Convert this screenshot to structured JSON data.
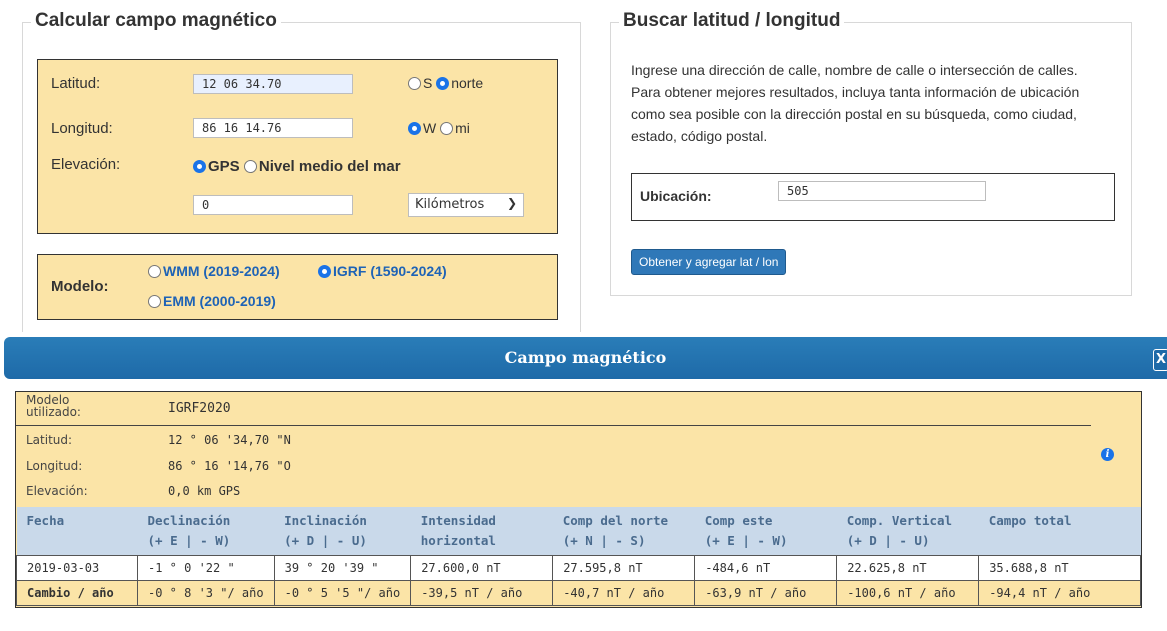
{
  "calc": {
    "title": "Calcular campo magnético",
    "lat_label": "Latitud:",
    "lat_value": "12 06 34.70",
    "lat_opt_s": "S",
    "lat_opt_n": "norte",
    "lat_selected": "norte",
    "lon_label": "Longitud:",
    "lon_value": "86 16 14.76",
    "lon_opt_w": "W",
    "lon_opt_e": "mi",
    "lon_selected": "W",
    "elev_label": "Elevación:",
    "elev_opt_gps": "GPS",
    "elev_opt_msl": "Nivel medio del mar",
    "elev_selected": "GPS",
    "elev_value": "0",
    "elev_unit": "Kilómetros",
    "model_label": "Modelo:",
    "model_opts": [
      "WMM (2019-2024)",
      "IGRF (1590-2024)",
      "EMM (2000-2019)"
    ],
    "model_selected": "IGRF (1590-2024)"
  },
  "search": {
    "title": "Buscar latitud / longitud",
    "description": "Ingrese una dirección de calle, nombre de calle o intersección de calles. Para obtener mejores resultados, incluya tanta información de ubicación como sea posible con la dirección postal en su búsqueda, como ciudad, estado, código postal.",
    "location_label": "Ubicación:",
    "location_value": "505",
    "button": "Obtener y agregar lat / lon"
  },
  "result": {
    "window_title": "Campo magnético",
    "close_label": "X",
    "model_label": "Modelo utilizado:",
    "model_value": "IGRF2020",
    "lat_label": "Latitud:",
    "lat_value": "12 ° 06 '34,70 \"N",
    "lon_label": "Longitud:",
    "lon_value": "86 ° 16 '14,76 \"O",
    "elev_label": "Elevación:",
    "elev_value": "0,0 km GPS",
    "headers": [
      [
        "Fecha",
        ""
      ],
      [
        "Declinación",
        "(+ E | - W)"
      ],
      [
        "Inclinación",
        "(+ D | - U)"
      ],
      [
        "Intensidad",
        "horizontal"
      ],
      [
        "Comp del norte",
        "(+ N | - S)"
      ],
      [
        "Comp este",
        "(+ E | - W)"
      ],
      [
        "Comp. Vertical",
        "(+ D | - U)"
      ],
      [
        "Campo total",
        ""
      ]
    ],
    "row": [
      "2019-03-03",
      "-1 ° 0 '22 \"",
      "39 ° 20 '39 \"",
      "27.600,0 nT",
      "27.595,8 nT",
      "-484,6 nT",
      "22.625,8 nT",
      "35.688,8 nT"
    ],
    "change": [
      "Cambio / año",
      "-0 ° 8 '3 \"/ año",
      "-0 ° 5 '5 \"/ año",
      "-39,5 nT / año",
      "-40,7 nT / año",
      "-63,9 nT / año",
      "-100,6 nT / año",
      "-94,4 nT / año"
    ]
  }
}
